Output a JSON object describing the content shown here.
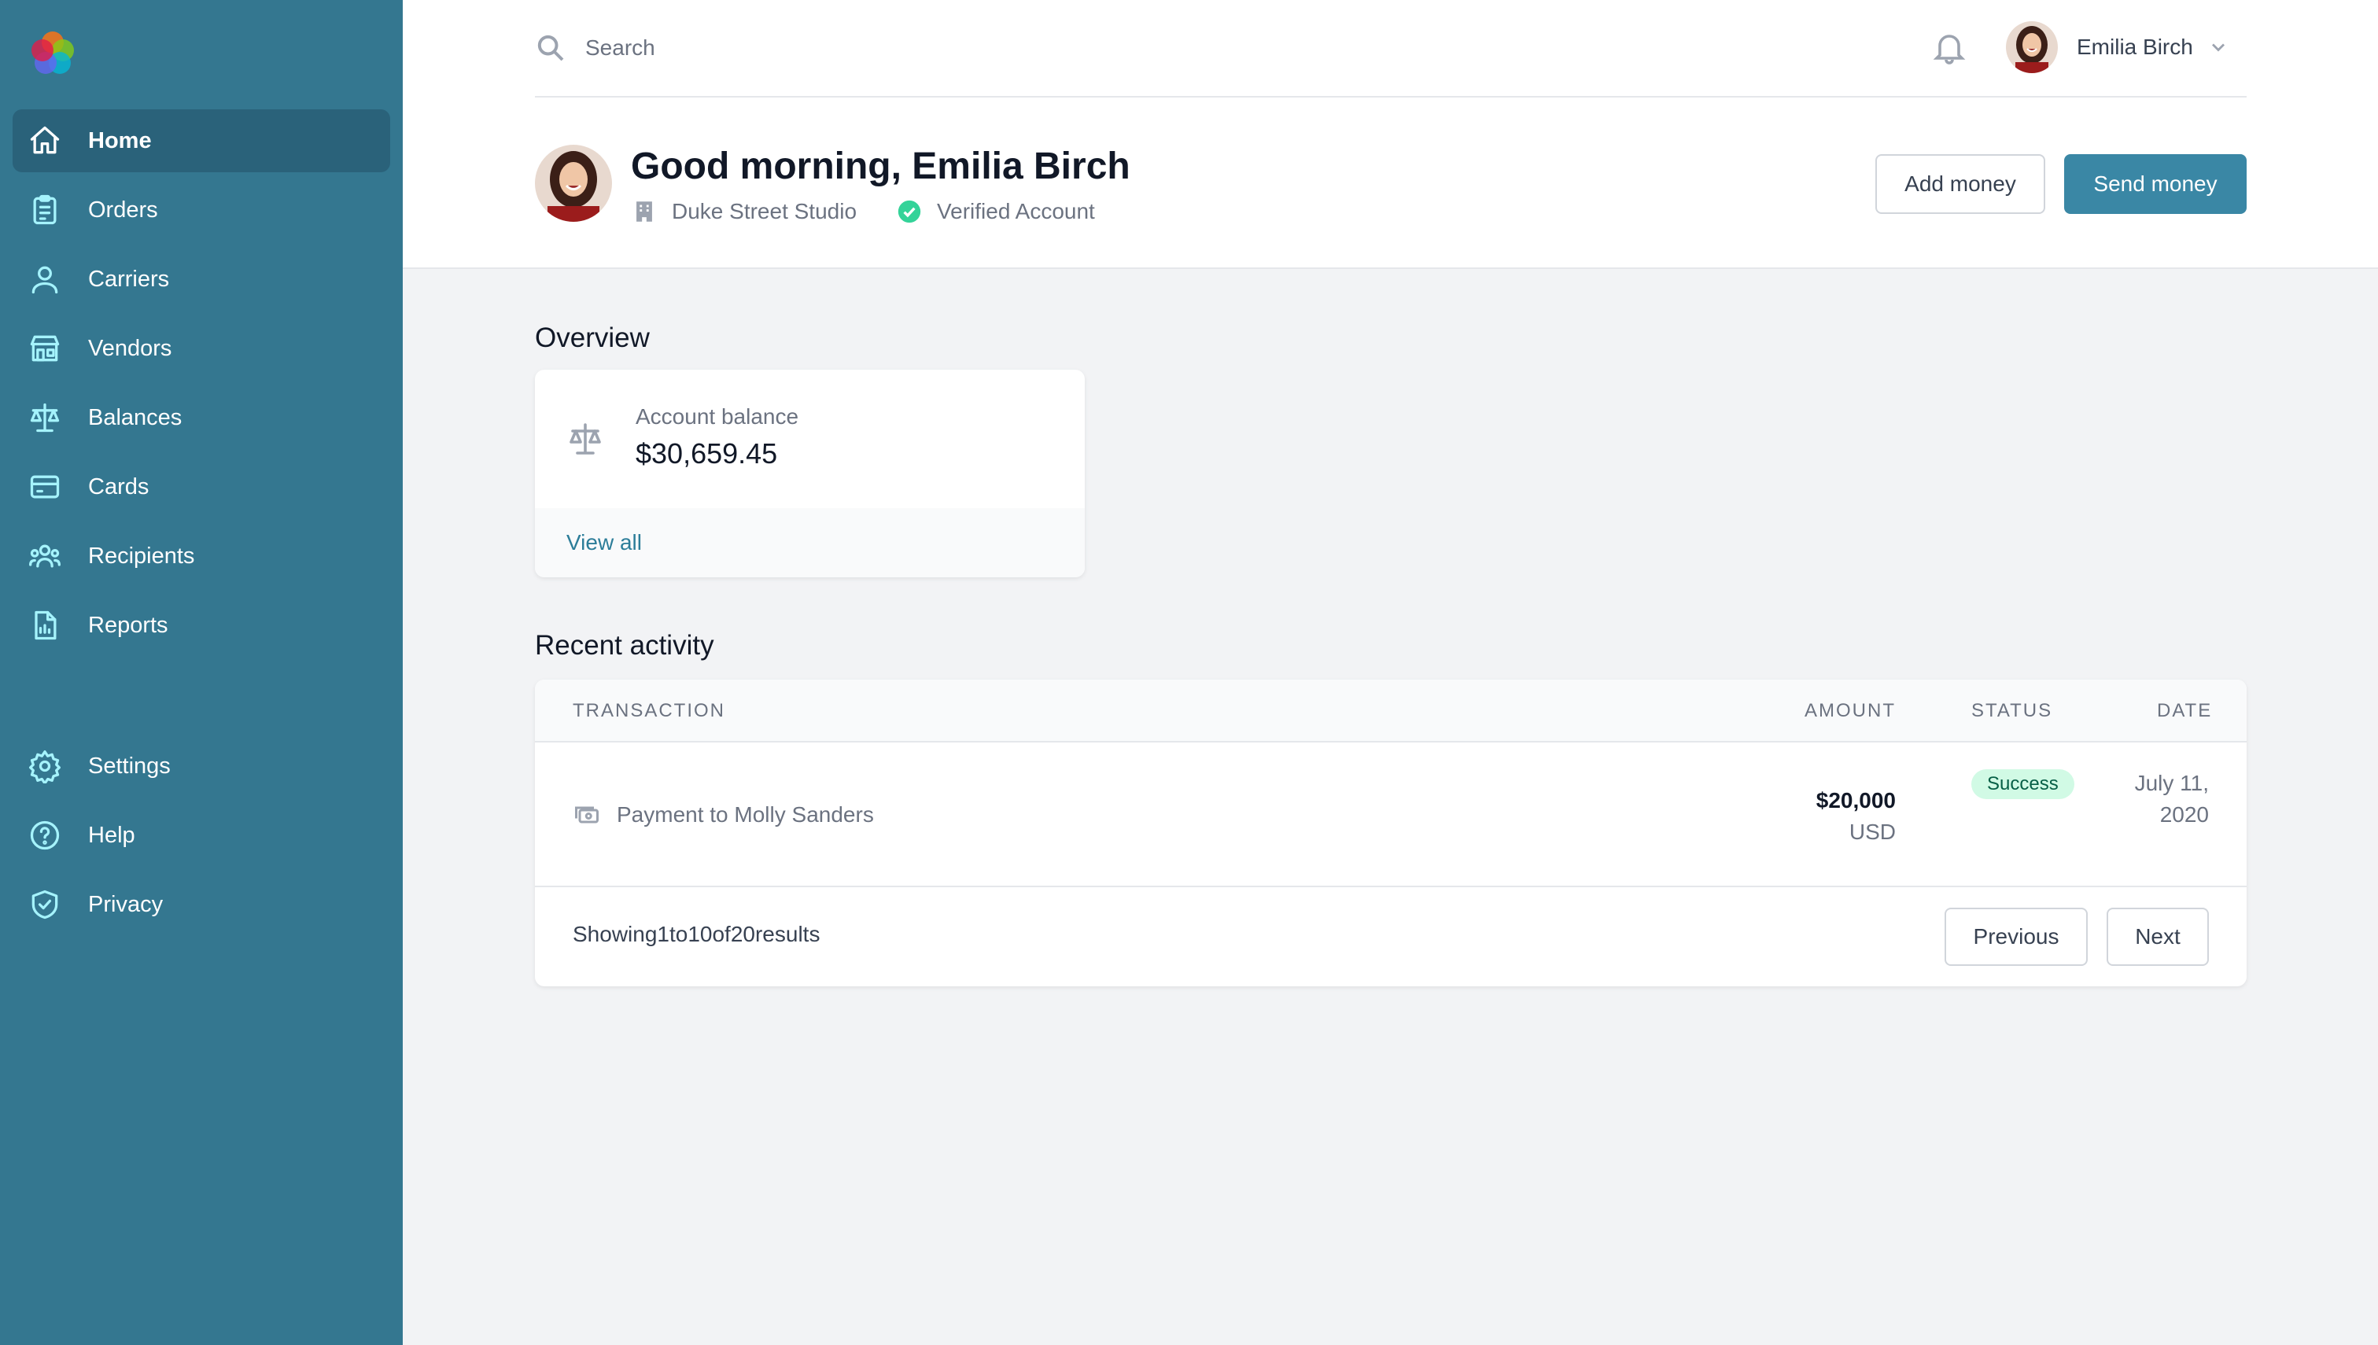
{
  "sidebar": {
    "items": [
      {
        "label": "Home",
        "icon": "home-icon",
        "active": true
      },
      {
        "label": "Orders",
        "icon": "clipboard-icon"
      },
      {
        "label": "Carriers",
        "icon": "user-icon"
      },
      {
        "label": "Vendors",
        "icon": "storefront-icon"
      },
      {
        "label": "Balances",
        "icon": "scale-icon"
      },
      {
        "label": "Cards",
        "icon": "credit-card-icon"
      },
      {
        "label": "Recipients",
        "icon": "user-group-icon"
      },
      {
        "label": "Reports",
        "icon": "document-report-icon"
      }
    ],
    "secondary": [
      {
        "label": "Settings",
        "icon": "gear-icon"
      },
      {
        "label": "Help",
        "icon": "question-circle-icon"
      },
      {
        "label": "Privacy",
        "icon": "shield-check-icon"
      }
    ]
  },
  "header": {
    "search_placeholder": "Search",
    "user_name": "Emilia Birch"
  },
  "greeting": {
    "title": "Good morning, Emilia Birch",
    "company": "Duke Street Studio",
    "verified": "Verified Account"
  },
  "actions": {
    "add_money": "Add money",
    "send_money": "Send money"
  },
  "overview": {
    "title": "Overview",
    "card_label": "Account balance",
    "card_value": "$30,659.45",
    "view_all": "View all"
  },
  "activity": {
    "title": "Recent activity",
    "columns": {
      "transaction": "TRANSACTION",
      "amount": "AMOUNT",
      "status": "STATUS",
      "date": "DATE"
    },
    "rows": [
      {
        "description": "Payment to Molly Sanders",
        "amount": "$20,000",
        "currency": "USD",
        "status": "Success",
        "date": "July 11, 2020"
      }
    ],
    "showing_text": "Showing1to10of20results",
    "previous": "Previous",
    "next": "Next"
  },
  "colors": {
    "sidebar": "#347790",
    "sidebar_active": "#2a627a",
    "accent": "#3a87a5",
    "success_bg": "#d1fae5",
    "success_text": "#065f46"
  }
}
